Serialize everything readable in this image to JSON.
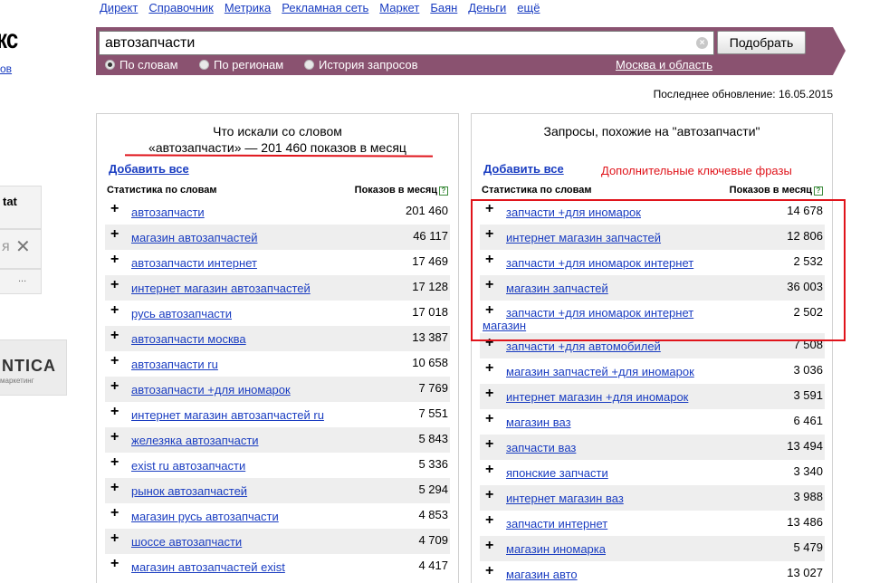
{
  "topnav": [
    "Директ",
    "Справочник",
    "Метрика",
    "Рекламная сеть",
    "Маркет",
    "Баян",
    "Деньги",
    "ещё"
  ],
  "logo_fragment": "кс",
  "logo_link_fragment": "ов",
  "left_fragments": {
    "stat": "tat",
    "search": "я",
    "dots": "...",
    "brand": "NTICA",
    "brand_sub": "маркетинг"
  },
  "search": {
    "value": "автозапчасти",
    "submit_label": "Подобрать",
    "options": [
      "По словам",
      "По регионам",
      "История запросов"
    ],
    "selected_option": "По словам",
    "region": "Москва и область"
  },
  "last_update": "Последнее обновление: 16.05.2015",
  "left_panel": {
    "title_line1": "Что искали со словом",
    "title_line2": "«автозапчасти» — 201 460 показов в месяц",
    "add_all": "Добавить все",
    "col_phrase": "Статистика по словам",
    "col_count": "Показов в месяц",
    "rows": [
      {
        "phrase": "автозапчасти",
        "count": "201 460"
      },
      {
        "phrase": "магазин автозапчастей",
        "count": "46 117"
      },
      {
        "phrase": "автозапчасти интернет",
        "count": "17 469"
      },
      {
        "phrase": "интернет магазин автозапчастей",
        "count": "17 128"
      },
      {
        "phrase": "русь автозапчасти",
        "count": "17 018"
      },
      {
        "phrase": "автозапчасти москва",
        "count": "13 387"
      },
      {
        "phrase": "автозапчасти ru",
        "count": "10 658"
      },
      {
        "phrase": "автозапчасти +для иномарок",
        "count": "7 769"
      },
      {
        "phrase": "интернет магазин автозапчастей ru",
        "count": "7 551"
      },
      {
        "phrase": "железяка автозапчасти",
        "count": "5 843"
      },
      {
        "phrase": "exist ru автозапчасти",
        "count": "5 336"
      },
      {
        "phrase": "рынок автозапчастей",
        "count": "5 294"
      },
      {
        "phrase": "магазин русь автозапчасти",
        "count": "4 853"
      },
      {
        "phrase": "шоссе автозапчасти",
        "count": "4 709"
      },
      {
        "phrase": "магазин автозапчастей exist",
        "count": "4 417"
      }
    ]
  },
  "right_panel": {
    "title": "Запросы, похожие на \"автозапчасти\"",
    "add_all": "Добавить все",
    "col_phrase": "Статистика по словам",
    "col_count": "Показов в месяц",
    "rows": [
      {
        "phrase": "запчасти +для иномарок",
        "count": "14 678"
      },
      {
        "phrase": "интернет магазин запчастей",
        "count": "12 806"
      },
      {
        "phrase": "запчасти +для иномарок интернет",
        "count": "2 532"
      },
      {
        "phrase": "магазин запчастей",
        "count": "36 003"
      },
      {
        "phrase": "запчасти +для иномарок интернет магазин",
        "count": "2 502"
      },
      {
        "phrase": "запчасти +для автомобилей",
        "count": "7 508"
      },
      {
        "phrase": "магазин запчастей +для иномарок",
        "count": "3 036"
      },
      {
        "phrase": "интернет магазин +для иномарок",
        "count": "3 591"
      },
      {
        "phrase": "магазин ваз",
        "count": "6 461"
      },
      {
        "phrase": "запчасти ваз",
        "count": "13 494"
      },
      {
        "phrase": "японские запчасти",
        "count": "3 340"
      },
      {
        "phrase": "интернет магазин ваз",
        "count": "3 988"
      },
      {
        "phrase": "запчасти интернет",
        "count": "13 486"
      },
      {
        "phrase": "магазин иномарка",
        "count": "5 479"
      },
      {
        "phrase": "магазин авто",
        "count": "13 027"
      }
    ]
  },
  "annotation": {
    "note": "Дополнительные ключевые фразы",
    "color": "#e0141b"
  }
}
